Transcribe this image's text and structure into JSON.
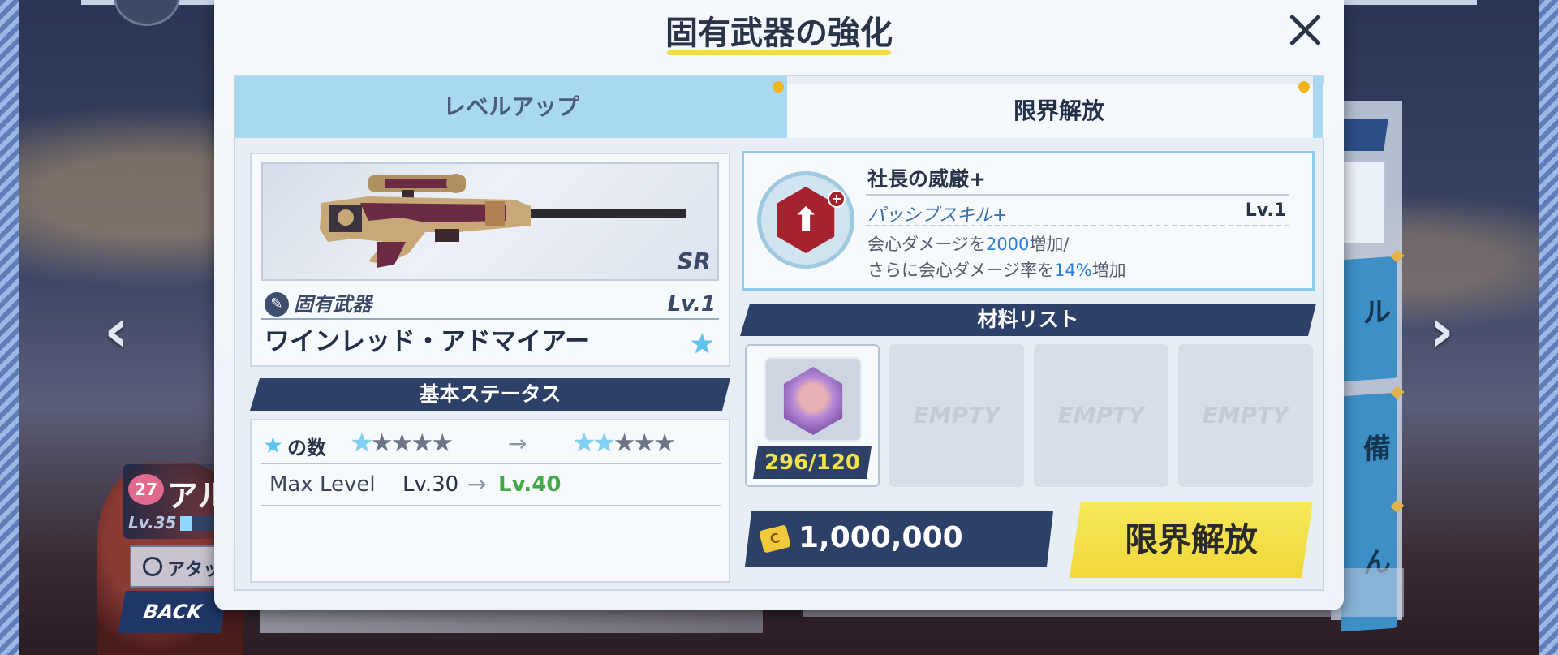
{
  "modal": {
    "title": "固有武器の強化",
    "tabs": [
      {
        "label": "レベルアップ",
        "active": false
      },
      {
        "label": "限界解放",
        "active": true
      }
    ]
  },
  "weapon": {
    "rarity": "SR",
    "type_label": "固有武器",
    "level": "Lv.1",
    "name": "ワインレッド・アドマイアー",
    "star_icon": "star-icon"
  },
  "status": {
    "header": "基本ステータス",
    "stars_label": "の数",
    "stars_from": {
      "filled": 1,
      "total": 5
    },
    "stars_to": {
      "filled": 2,
      "total": 5
    },
    "max_level_label": "Max Level",
    "max_level_from": "Lv.30",
    "max_level_to": "Lv.40",
    "arrow": "→"
  },
  "skill": {
    "name": "社長の威厳+",
    "type": "パッシブスキル+",
    "level": "Lv.1",
    "desc_line1_a": "会心ダメージを",
    "desc_line1_value": "2000",
    "desc_line1_b": "増加/",
    "desc_line2_a": "さらに会心ダメージ率を",
    "desc_line2_value": "14%",
    "desc_line2_b": "増加"
  },
  "materials": {
    "header": "材料リスト",
    "items": [
      {
        "count": "296/120"
      }
    ],
    "empty_label": "EMPTY"
  },
  "cost": {
    "value": "1,000,000"
  },
  "action_button": "限界解放",
  "background": {
    "char_level_badge": "27",
    "char_name": "アル",
    "char_lv": "Lv.35",
    "atk_label": "アタッ",
    "back_label": "BACK",
    "right_card_1": "ル",
    "right_card_2": "備",
    "right_card_3": "ん"
  },
  "colors": {
    "accent_yellow": "#f0dc55",
    "tab_blue": "#a9d8f1",
    "navy": "#2c4068",
    "highlight_blue": "#2b7fd6",
    "green": "#44a84a"
  }
}
